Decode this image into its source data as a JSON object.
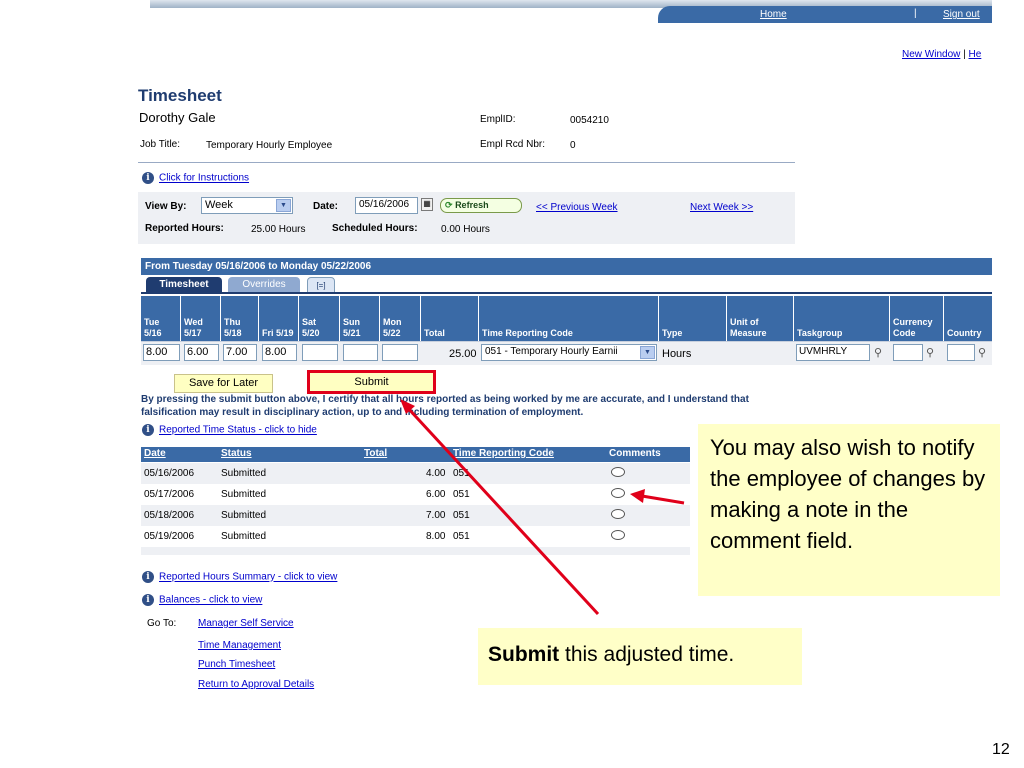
{
  "topnav": {
    "home": "Home",
    "separator": "|",
    "signout": "Sign out"
  },
  "links_top": {
    "new_window": "New Window",
    "pipe": "|",
    "help": "He"
  },
  "header": {
    "title": "Timesheet",
    "employee_name": "Dorothy Gale",
    "emplid_label": "EmplID:",
    "emplid_value": "0054210",
    "job_title_label": "Job Title:",
    "job_title_value": "Temporary Hourly Employee",
    "empl_rcd_label": "Empl Rcd Nbr:",
    "empl_rcd_value": "0"
  },
  "instructions_link": "Click for Instructions",
  "view": {
    "view_by_label": "View By:",
    "view_by_value": "Week",
    "date_label": "Date:",
    "date_value": "05/16/2006",
    "refresh_label": "Refresh",
    "prev_week": "<< Previous Week",
    "next_week": "Next Week >>",
    "reported_hours_label": "Reported Hours:",
    "reported_hours_value": "25.00 Hours",
    "scheduled_hours_label": "Scheduled Hours:",
    "scheduled_hours_value": "0.00 Hours"
  },
  "period": "From Tuesday 05/16/2006 to Monday 05/22/2006",
  "tabs": {
    "timesheet": "Timesheet",
    "overrides": "Overrides",
    "grid": "[=]"
  },
  "grid": {
    "headers": {
      "tue": "Tue 5/16",
      "wed": "Wed 5/17",
      "thu": "Thu 5/18",
      "fri": "Fri 5/19",
      "sat": "Sat 5/20",
      "sun": "Sun 5/21",
      "mon": "Mon 5/22",
      "total": "Total",
      "trc": "Time Reporting Code",
      "type": "Type",
      "uom": "Unit of Measure",
      "taskgroup": "Taskgroup",
      "currency": "Currency Code",
      "country": "Country"
    },
    "row": {
      "tue": "8.00",
      "wed": "6.00",
      "thu": "7.00",
      "fri": "8.00",
      "sat": "",
      "sun": "",
      "mon": "",
      "total": "25.00",
      "trc": "051 - Temporary Hourly Earnii",
      "type": "Hours",
      "uom": "",
      "taskgroup": "UVMHRLY",
      "currency": "",
      "country": ""
    }
  },
  "buttons": {
    "save_for_later": "Save for Later",
    "submit": "Submit"
  },
  "certify_text": "By pressing the submit button above, I certify that all hours reported as being worked by me are accurate, and I understand that falsification may result in disciplinary action, up to and including termination of employment.",
  "reported_status_link": "Reported Time Status - click to hide",
  "status_table": {
    "headers": {
      "date": "Date",
      "status": "Status",
      "total": "Total",
      "trc": "Time Reporting Code",
      "comments": "Comments"
    },
    "rows": [
      {
        "date": "05/16/2006",
        "status": "Submitted",
        "total": "4.00",
        "trc": "051"
      },
      {
        "date": "05/17/2006",
        "status": "Submitted",
        "total": "6.00",
        "trc": "051"
      },
      {
        "date": "05/18/2006",
        "status": "Submitted",
        "total": "7.00",
        "trc": "051"
      },
      {
        "date": "05/19/2006",
        "status": "Submitted",
        "total": "8.00",
        "trc": "051"
      }
    ]
  },
  "summary_link": "Reported Hours Summary - click to view",
  "balances_link": "Balances - click to view",
  "goto": {
    "label": "Go To:",
    "links": [
      "Manager Self Service",
      "Time Management",
      "Punch Timesheet",
      "Return to Approval Details"
    ]
  },
  "callouts": {
    "comment_note": "You may also wish to notify the employee of changes by making a note in the comment field.",
    "submit_bold": "Submit",
    "submit_rest": " this adjusted time."
  },
  "page_number": "12",
  "colors": {
    "header_blue": "#3a6aa6",
    "callout_yellow": "#ffffc8",
    "arrow_red": "#e0001a"
  }
}
